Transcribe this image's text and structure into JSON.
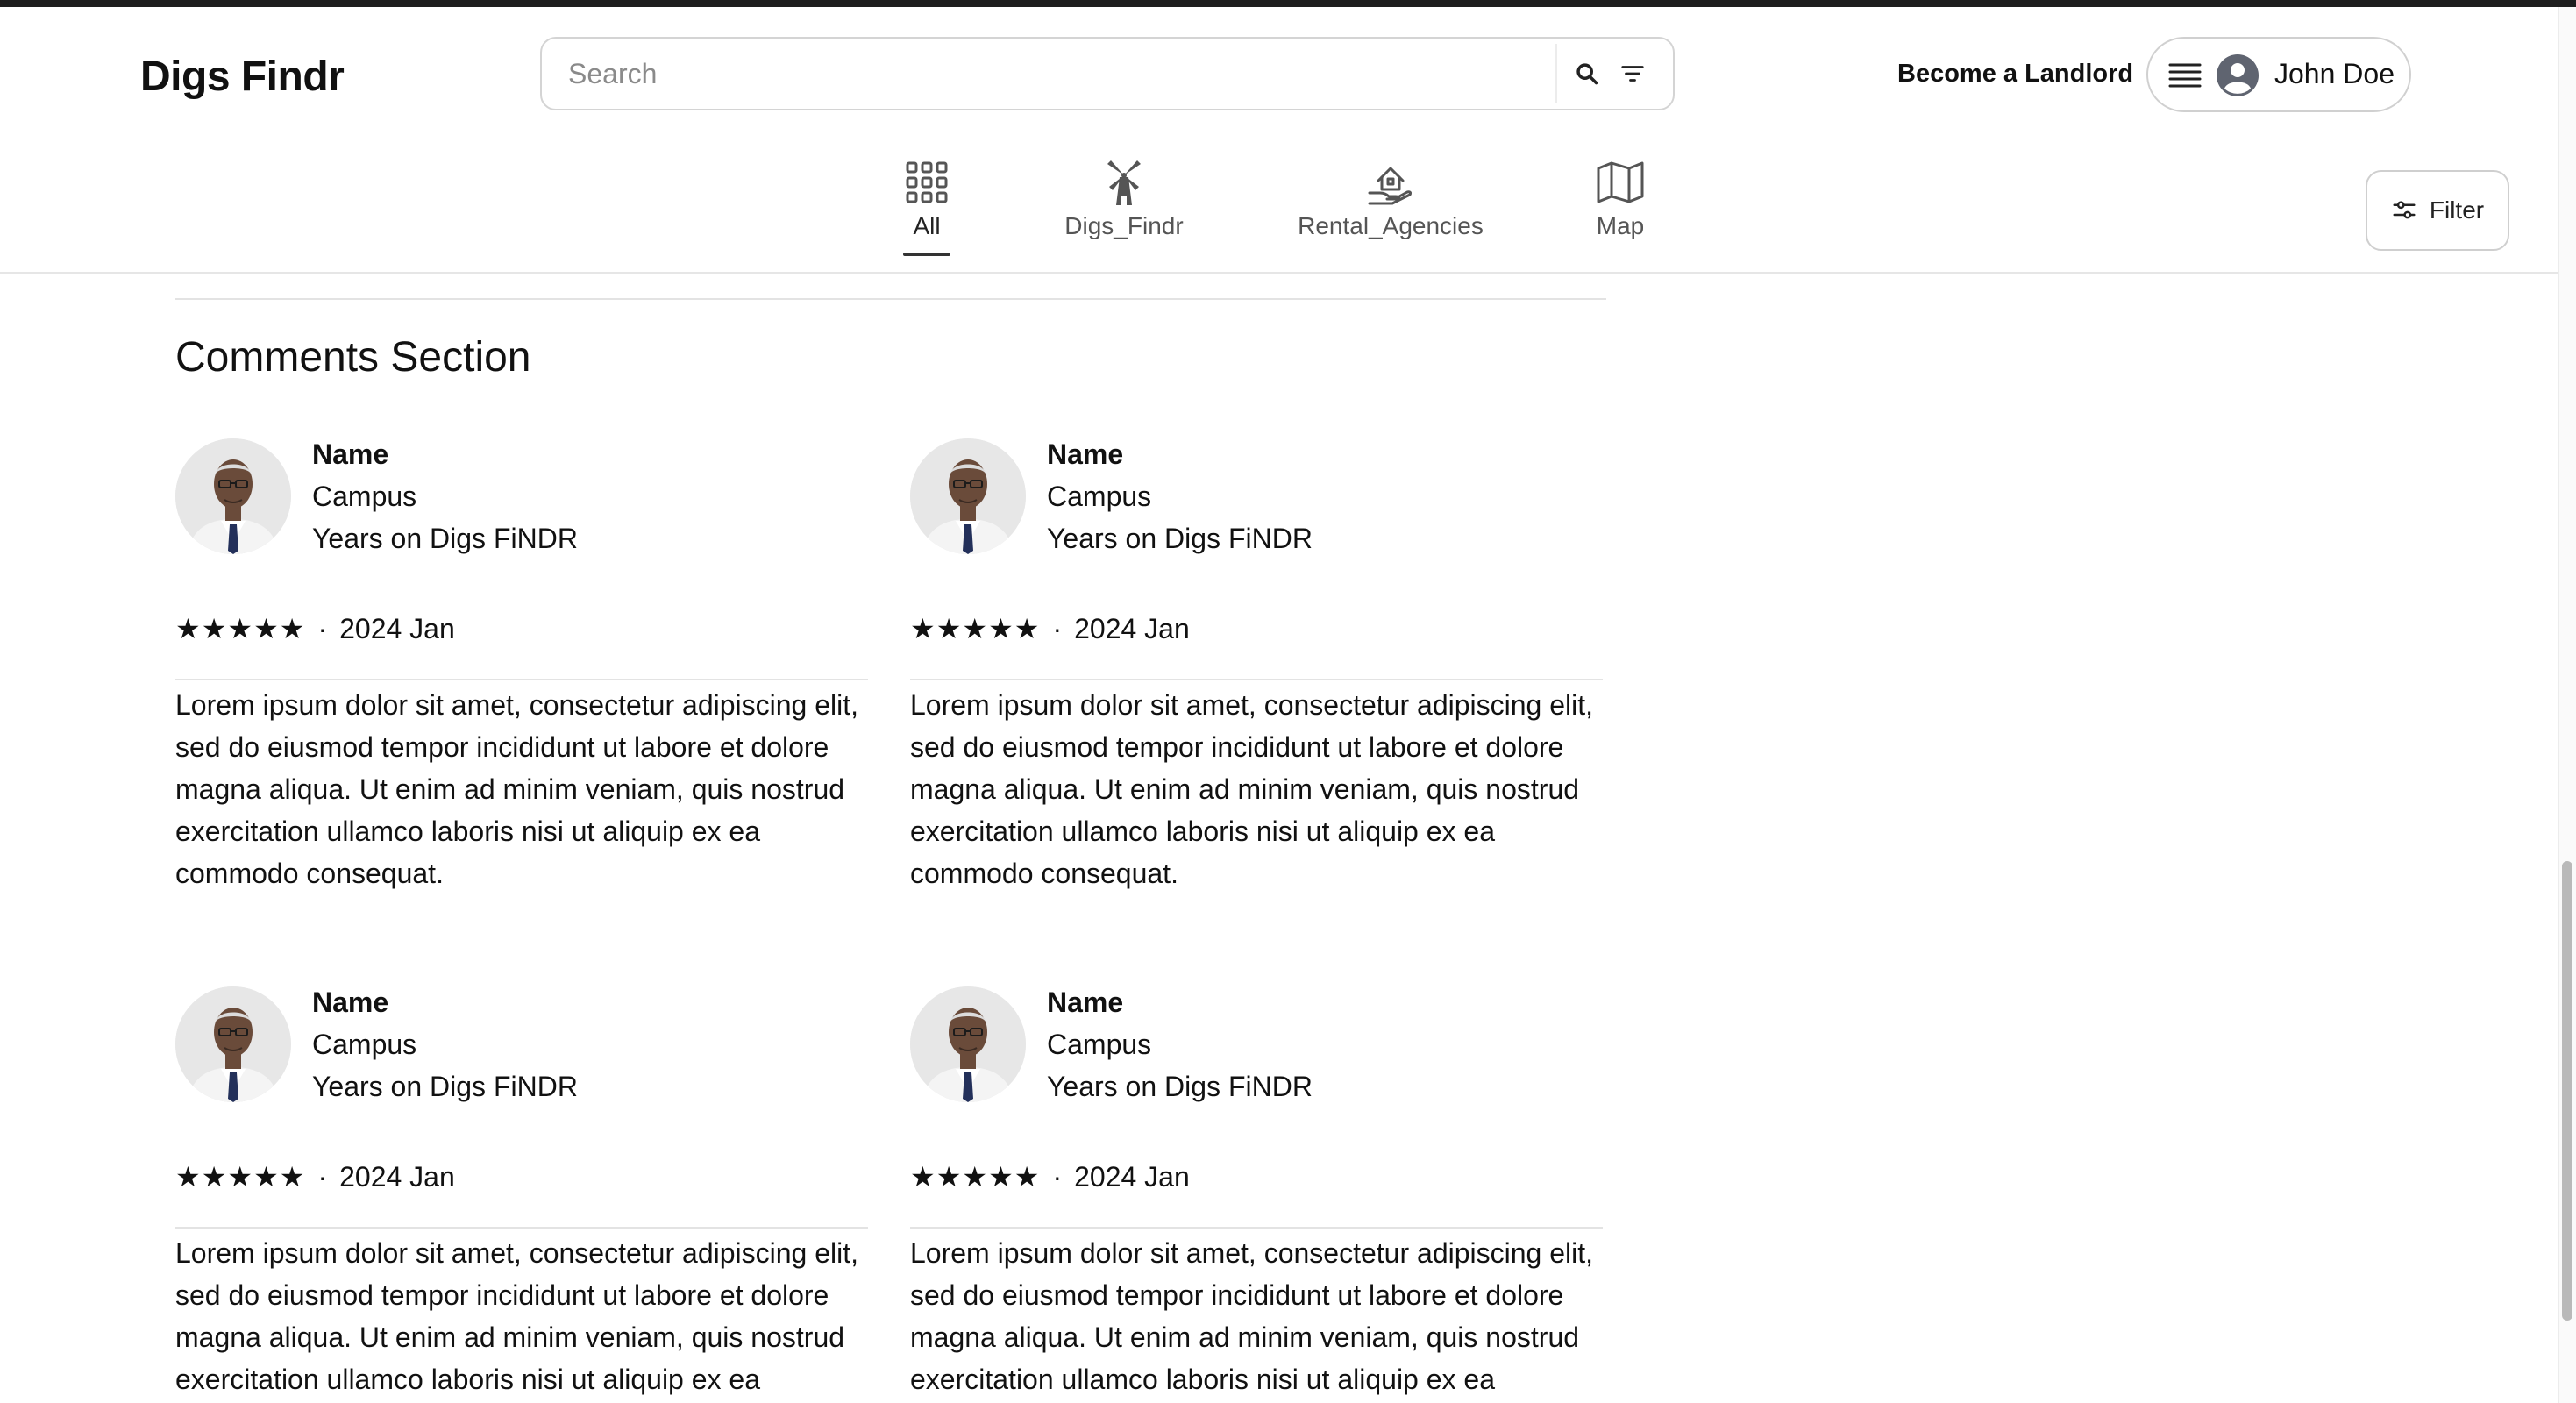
{
  "app": {
    "title": "Digs Findr"
  },
  "search": {
    "placeholder": "Search"
  },
  "header": {
    "become_landlord": "Become a Landlord",
    "user_name": "John Doe"
  },
  "tabs": [
    {
      "label": "All",
      "icon": "grid-icon",
      "active": true
    },
    {
      "label": "Digs_Findr",
      "icon": "windmill-icon",
      "active": false
    },
    {
      "label": "Rental_Agencies",
      "icon": "house-hand-icon",
      "active": false
    },
    {
      "label": "Map",
      "icon": "map-icon",
      "active": false
    }
  ],
  "filter_button": {
    "label": "Filter"
  },
  "comments": {
    "title": "Comments Section",
    "items": [
      {
        "name": "Name",
        "campus": "Campus",
        "years": "Years on Digs FiNDR",
        "stars": "★★★★★",
        "separator": "·",
        "date": "2024 Jan",
        "text": "Lorem ipsum dolor sit amet, consectetur adipiscing elit, sed do eiusmod tempor incididunt ut labore et dolore magna aliqua. Ut enim ad minim veniam, quis nostrud exercitation ullamco laboris nisi ut aliquip ex ea commodo consequat."
      },
      {
        "name": "Name",
        "campus": "Campus",
        "years": "Years on Digs FiNDR",
        "stars": "★★★★★",
        "separator": "·",
        "date": "2024 Jan",
        "text": "Lorem ipsum dolor sit amet, consectetur adipiscing elit, sed do eiusmod tempor incididunt ut labore et dolore magna aliqua. Ut enim ad minim veniam, quis nostrud exercitation ullamco laboris nisi ut aliquip ex ea commodo consequat."
      },
      {
        "name": "Name",
        "campus": "Campus",
        "years": "Years on Digs FiNDR",
        "stars": "★★★★★",
        "separator": "·",
        "date": "2024 Jan",
        "text": "Lorem ipsum dolor sit amet, consectetur adipiscing elit, sed do eiusmod tempor incididunt ut labore et dolore magna aliqua. Ut enim ad minim veniam, quis nostrud exercitation ullamco laboris nisi ut aliquip ex ea commodo consequat."
      },
      {
        "name": "Name",
        "campus": "Campus",
        "years": "Years on Digs FiNDR",
        "stars": "★★★★★",
        "separator": "·",
        "date": "2024 Jan",
        "text": "Lorem ipsum dolor sit amet, consectetur adipiscing elit, sed do eiusmod tempor incididunt ut labore et dolore magna aliqua. Ut enim ad minim veniam, quis nostrud exercitation ullamco laboris nisi ut aliquip ex ea commodo consequat."
      }
    ]
  },
  "colors": {
    "text": "#111111",
    "muted": "#555555",
    "border": "#d4d4d4",
    "divider": "#e3e3e3"
  }
}
